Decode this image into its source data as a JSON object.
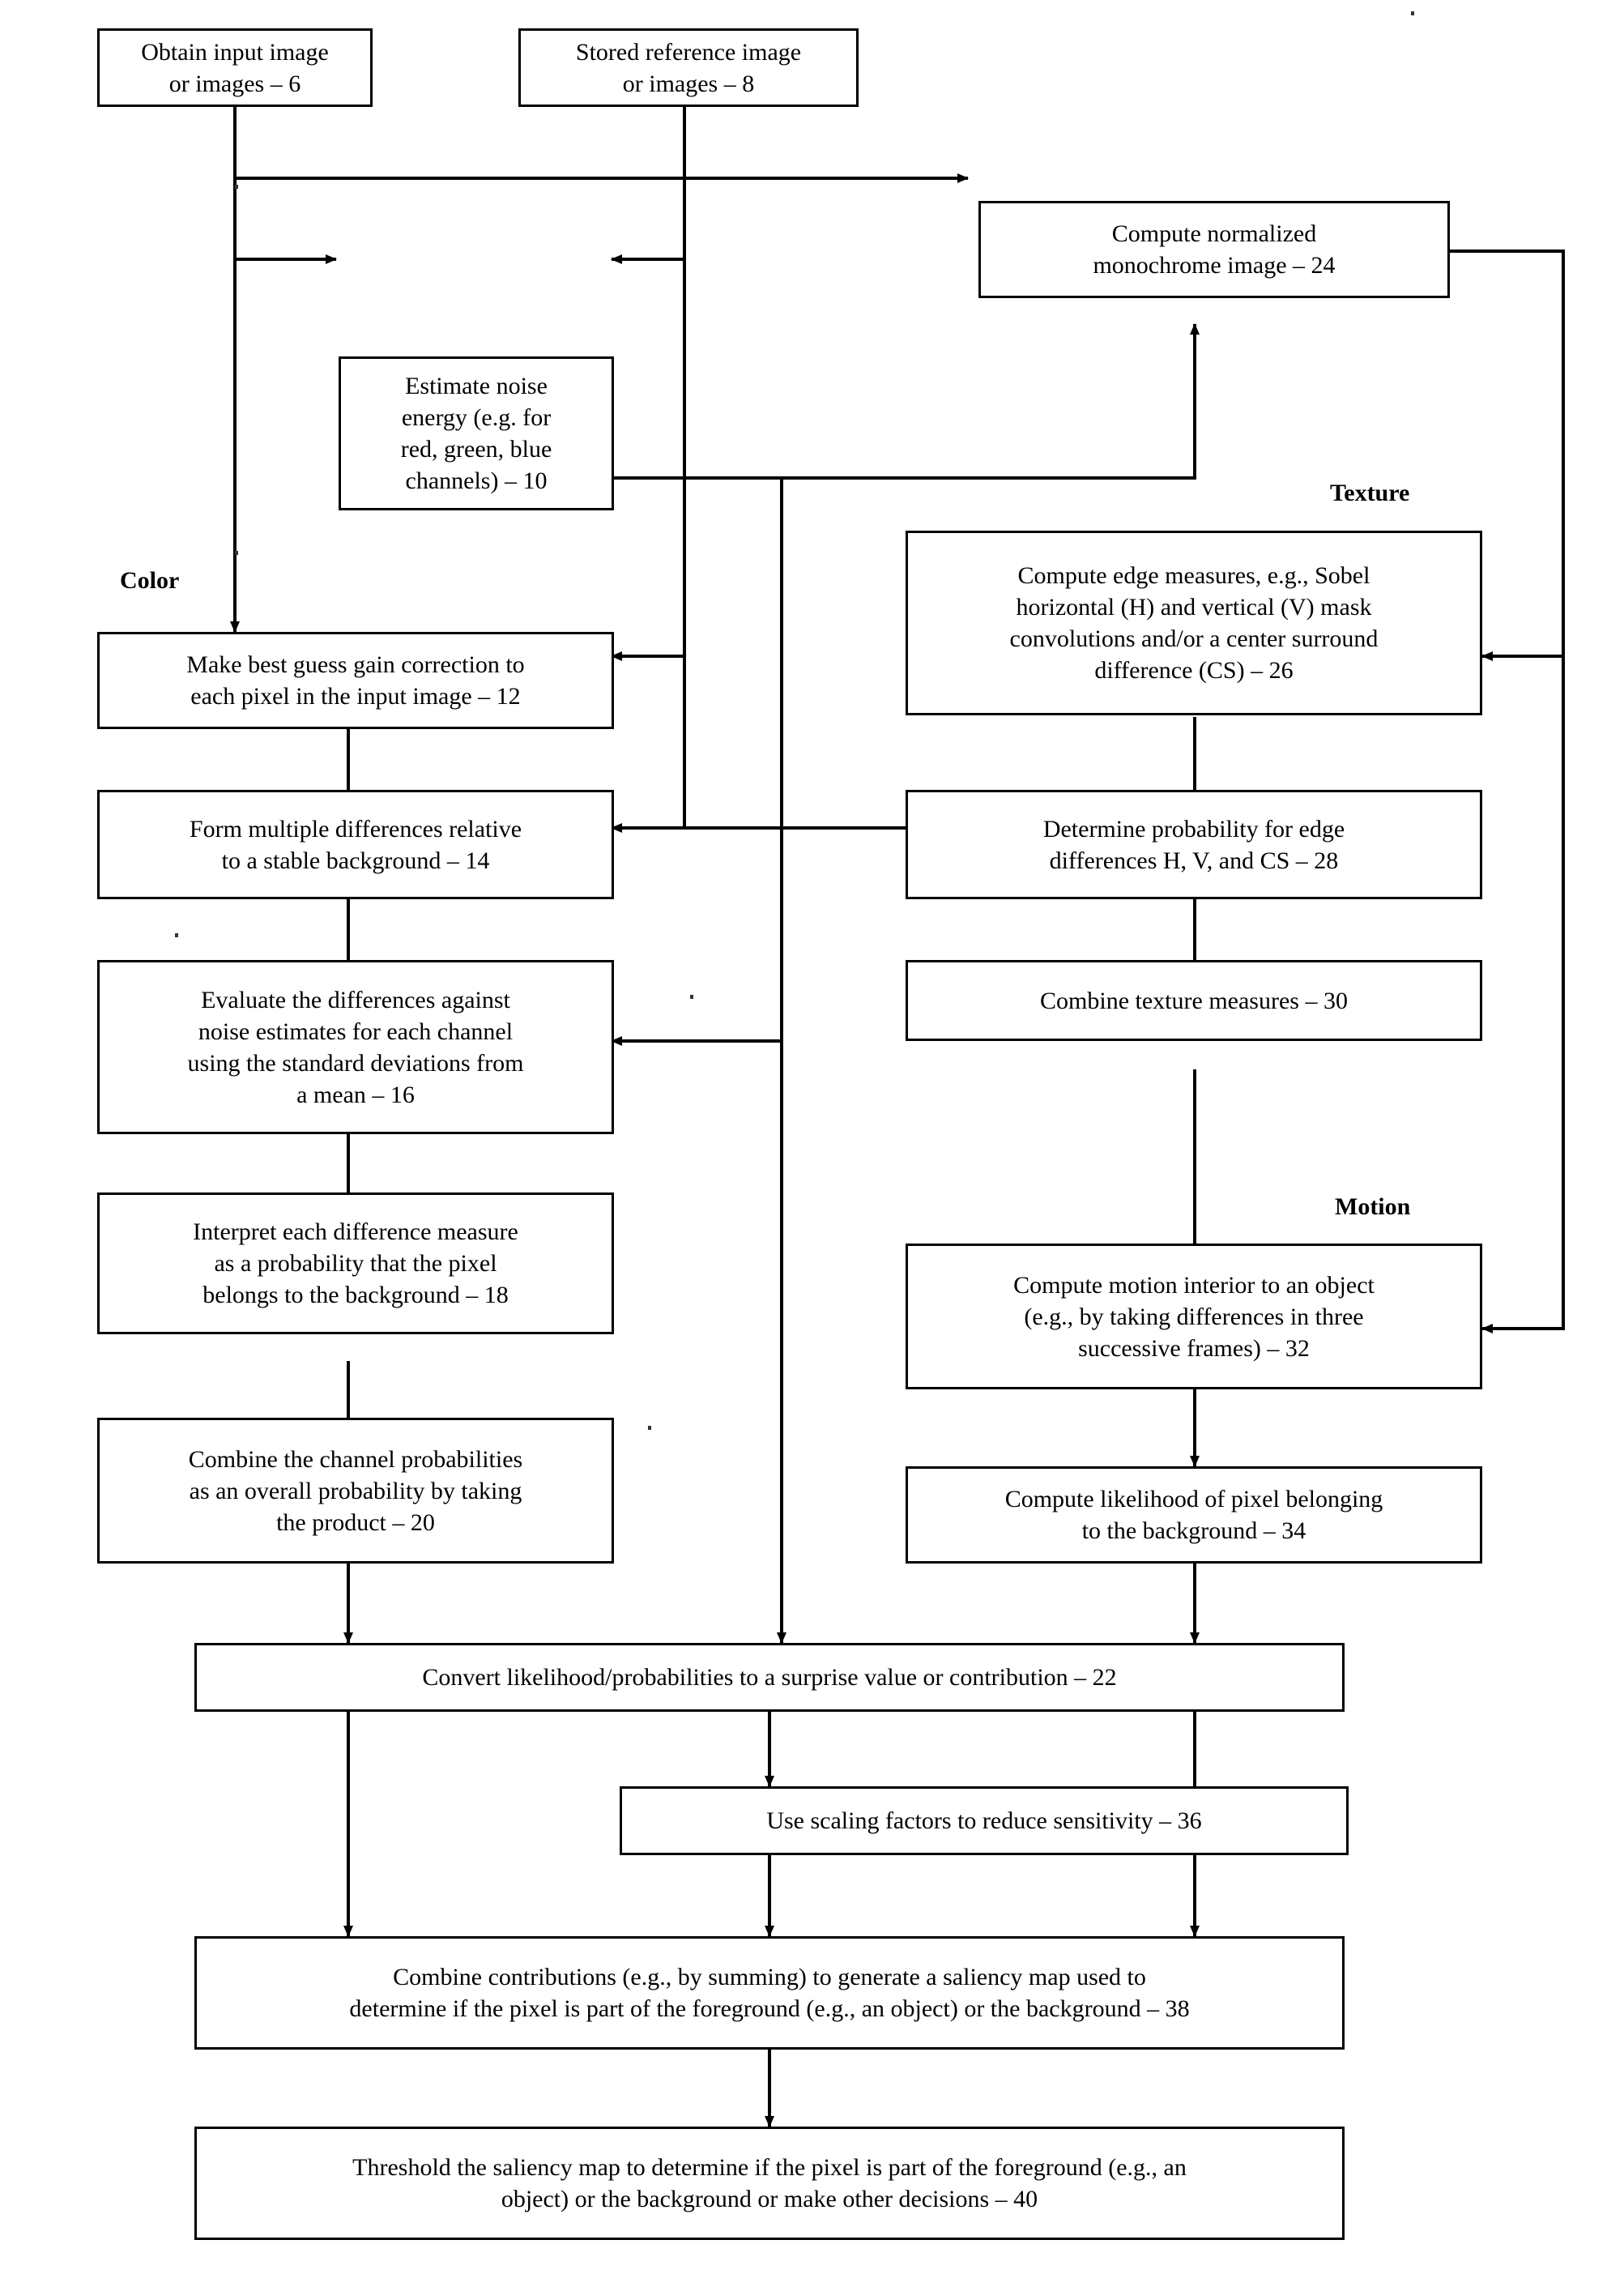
{
  "figure": {
    "type": "flowchart",
    "title": "Saliency-based foreground/background detection flow diagram",
    "group_labels": [
      {
        "name": "color",
        "text": "Color"
      },
      {
        "name": "texture",
        "text": "Texture"
      },
      {
        "name": "motion",
        "text": "Motion"
      }
    ]
  },
  "nodes": {
    "n6": {
      "ref": "6",
      "text": "Obtain input image\nor images – 6"
    },
    "n8": {
      "ref": "8",
      "text": "Stored reference image\nor images – 8"
    },
    "n24": {
      "ref": "24",
      "text": "Compute normalized\nmonochrome image – 24"
    },
    "n10": {
      "ref": "10",
      "text": "Estimate noise\nenergy (e.g. for\nred, green, blue\nchannels) – 10"
    },
    "n26": {
      "ref": "26",
      "text": "Compute edge measures, e.g., Sobel\nhorizontal (H) and vertical (V) mask\nconvolutions and/or a center surround\ndifference (CS) – 26"
    },
    "n12": {
      "ref": "12",
      "text": "Make best guess gain correction to\neach pixel in the input image – 12"
    },
    "n14": {
      "ref": "14",
      "text": "Form multiple differences relative\nto a stable background – 14"
    },
    "n28": {
      "ref": "28",
      "text": "Determine probability for edge\ndifferences H, V, and CS – 28"
    },
    "n16": {
      "ref": "16",
      "text": "Evaluate the differences against\nnoise estimates for each channel\nusing the standard deviations from\na mean – 16"
    },
    "n30": {
      "ref": "30",
      "text": "Combine texture measures – 30"
    },
    "n18": {
      "ref": "18",
      "text": "Interpret each difference measure\nas a probability that the pixel\nbelongs to the background – 18"
    },
    "n32": {
      "ref": "32",
      "text": "Compute motion interior to an object\n(e.g., by taking differences in three\nsuccessive frames) – 32"
    },
    "n20": {
      "ref": "20",
      "text": "Combine the channel probabilities\nas an overall probability by taking\nthe product – 20"
    },
    "n34": {
      "ref": "34",
      "text": "Compute likelihood of pixel belonging\nto the background – 34"
    },
    "n22": {
      "ref": "22",
      "text": "Convert likelihood/probabilities to a surprise value or contribution – 22"
    },
    "n36": {
      "ref": "36",
      "text": "Use scaling factors to reduce sensitivity – 36"
    },
    "n38": {
      "ref": "38",
      "text": "Combine contributions (e.g., by summing) to generate a saliency map used to\ndetermine if the pixel is part of the foreground (e.g., an object) or the background – 38"
    },
    "n40": {
      "ref": "40",
      "text": "Threshold the saliency map to determine if the pixel is part of the foreground (e.g., an\nobject) or the background or make other decisions – 40"
    }
  },
  "edges": [
    {
      "from": "n6",
      "to": "n10"
    },
    {
      "from": "n6",
      "to": "n12"
    },
    {
      "from": "n6",
      "to": "n24"
    },
    {
      "from": "n8",
      "to": "n10"
    },
    {
      "from": "n8",
      "to": "n12"
    },
    {
      "from": "n8",
      "to": "n14"
    },
    {
      "from": "n8",
      "to": "n16"
    },
    {
      "from": "n8",
      "to": "n28"
    },
    {
      "from": "n10",
      "to": "n24"
    },
    {
      "from": "n10",
      "to": "n22"
    },
    {
      "from": "n12",
      "to": "n14"
    },
    {
      "from": "n14",
      "to": "n16"
    },
    {
      "from": "n16",
      "to": "n18"
    },
    {
      "from": "n18",
      "to": "n20"
    },
    {
      "from": "n20",
      "to": "n22"
    },
    {
      "from": "n24",
      "to": "n26"
    },
    {
      "from": "n24",
      "to": "n32"
    },
    {
      "from": "n26",
      "to": "n28"
    },
    {
      "from": "n28",
      "to": "n30"
    },
    {
      "from": "n30",
      "to": "n22"
    },
    {
      "from": "n32",
      "to": "n34"
    },
    {
      "from": "n34",
      "to": "n22"
    },
    {
      "from": "n22",
      "to": "n36"
    },
    {
      "from": "n22",
      "to": "n38"
    },
    {
      "from": "n36",
      "to": "n38"
    },
    {
      "from": "n38",
      "to": "n40"
    }
  ],
  "colors": {
    "stroke": "#000000",
    "background": "#ffffff",
    "text": "#000000"
  }
}
